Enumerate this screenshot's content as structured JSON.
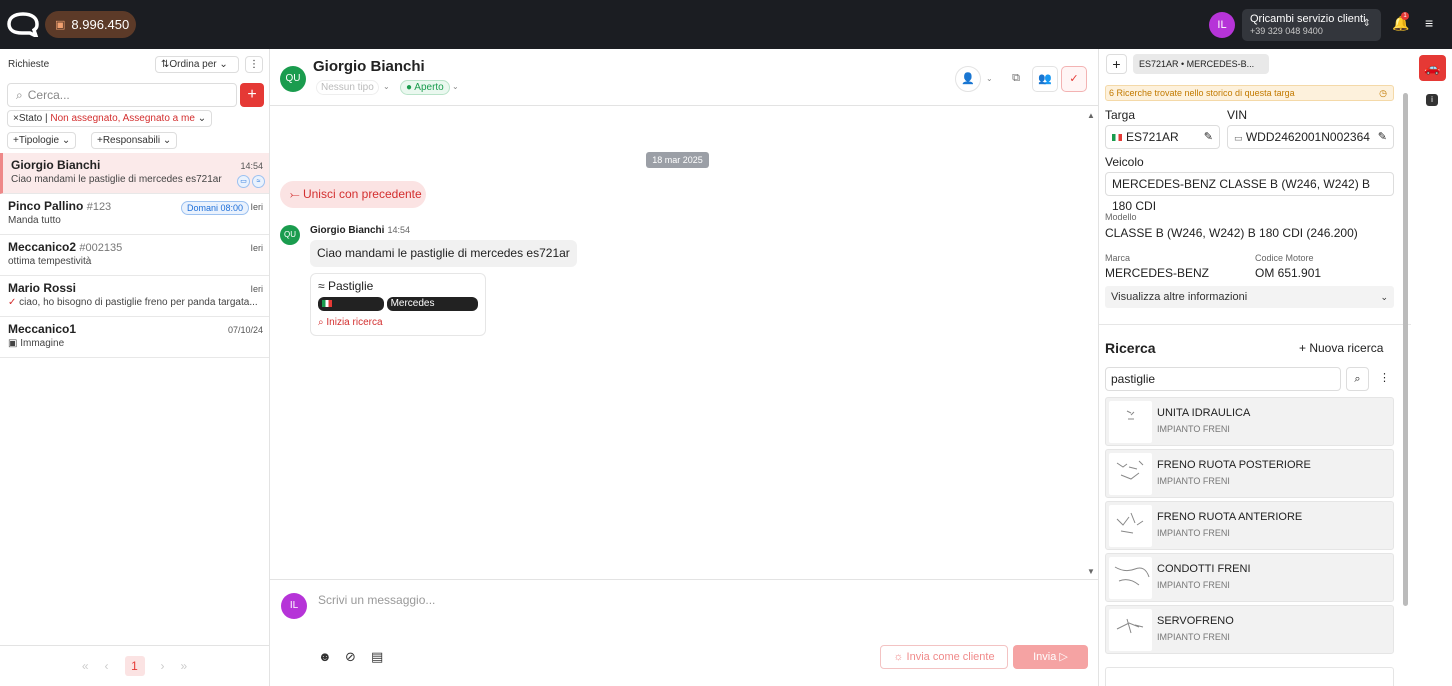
{
  "topbar": {
    "credits": "8.996.450",
    "user_initials": "IL",
    "account_name": "Qricambi servizio clienti",
    "account_phone": "+39 329 048 9400",
    "notification_count": "1"
  },
  "left": {
    "title": "Richieste",
    "sort_label": "Ordina per",
    "search_placeholder": "Cerca...",
    "filter_state_label": "Stato",
    "filter_state_value": "Non assegnato, Assegnato a me",
    "filter_types": "+Tipologie",
    "filter_owners": "+Responsabili",
    "conversations": [
      {
        "name": "Giorgio Bianchi",
        "tag": "",
        "preview": "Ciao mandami le pastiglie di mercedes es721ar",
        "time": "14:54"
      },
      {
        "name": "Pinco Pallino",
        "tag": "#123",
        "preview": "Manda tutto",
        "time": "Ieri",
        "badge": "Domani 08:00"
      },
      {
        "name": "Meccanico2",
        "tag": "#002135",
        "preview": "ottima tempestività",
        "time": "Ieri"
      },
      {
        "name": "Mario Rossi",
        "tag": "",
        "preview": "ciao, ho bisogno di pastiglie freno per panda targata...",
        "time": "Ieri"
      },
      {
        "name": "Meccanico1",
        "tag": "",
        "preview": "Immagine",
        "time": "07/10/24"
      }
    ],
    "pager": {
      "current": "1"
    }
  },
  "chat": {
    "contact_initials": "QU",
    "contact_name": "Giorgio Bianchi",
    "type_label": "Nessun tipo",
    "status_label": "Aperto",
    "date_separator": "18 mar 2025",
    "merge_label": "Unisci con precedente",
    "message": {
      "author": "Giorgio Bianchi",
      "time": "14:54",
      "text": "Ciao mandami le pastiglie di mercedes es721ar",
      "card_title": "Pastiglie",
      "card_tag_plate": "ES721AR",
      "card_tag_vehicle": "Mercedes Es721ar",
      "card_action": "Inizia ricerca"
    },
    "composer_initials": "IL",
    "composer_placeholder": "Scrivi un messaggio...",
    "send_as_client": "Invia come cliente",
    "send": "Invia"
  },
  "right": {
    "plate_tab": "ES721AR • MERCEDES-B...",
    "history_note": "6 Ricerche trovate nello storico di questa targa",
    "plate_label": "Targa",
    "plate_value": "ES721AR",
    "vin_label": "VIN",
    "vin_value": "WDD2462001N002364",
    "vehicle_label": "Veicolo",
    "vehicle_value": "MERCEDES-BENZ CLASSE B (W246, W242) B 180 CDI",
    "model_label": "Modello",
    "model_value": "CLASSE B (W246, W242) B 180 CDI (246.200)",
    "brand_label": "Marca",
    "brand_value": "MERCEDES-BENZ",
    "engine_label": "Codice Motore",
    "engine_value": "OM 651.901",
    "more_info": "Visualizza altre informazioni",
    "search_title": "Ricerca",
    "new_search": "+ Nuova ricerca",
    "search_value": "pastiglie",
    "results": [
      {
        "name": "UNITA IDRAULICA",
        "group": "IMPIANTO FRENI"
      },
      {
        "name": "FRENO RUOTA POSTERIORE",
        "group": "IMPIANTO FRENI"
      },
      {
        "name": "FRENO RUOTA ANTERIORE",
        "group": "IMPIANTO FRENI"
      },
      {
        "name": "CONDOTTI FRENI",
        "group": "IMPIANTO FRENI"
      },
      {
        "name": "SERVOFRENO",
        "group": "IMPIANTO FRENI"
      }
    ]
  },
  "colors": {
    "accent": "#e53935",
    "topbar": "#1b1d22",
    "online": "#1a9c4e",
    "user": "#b634d8"
  }
}
